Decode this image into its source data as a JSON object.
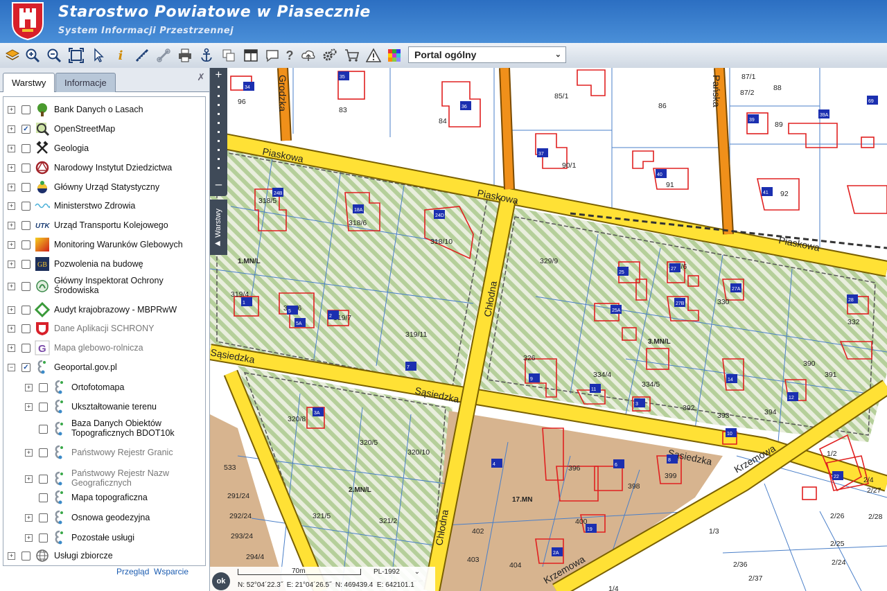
{
  "header": {
    "title": "Starostwo Powiatowe w Piasecznie",
    "subtitle": "System Informacji Przestrzennej"
  },
  "toolbar": {
    "icons": [
      "layers-icon",
      "zoom-in-icon",
      "zoom-out-icon",
      "full-extent-icon",
      "pointer-icon",
      "info-icon",
      "measure-distance-icon",
      "measure-area-icon",
      "print-icon",
      "anchor-icon",
      "copy-icon",
      "layout-icon",
      "comment-icon",
      "help-icon",
      "upload-icon",
      "settings-icon",
      "cart-icon",
      "warning-icon",
      "grid-color-icon"
    ],
    "portal_select": "Portal ogólny"
  },
  "panel": {
    "tabs": [
      "Warstwy",
      "Informacje"
    ],
    "layers": [
      {
        "label": "Bank Danych o Lasach",
        "checked": false,
        "expandable": true,
        "level": 0,
        "muted": false,
        "icon": "tree-icon"
      },
      {
        "label": "OpenStreetMap",
        "checked": true,
        "expandable": true,
        "level": 0,
        "muted": false,
        "icon": "magnifier-map-icon"
      },
      {
        "label": "Geologia",
        "checked": false,
        "expandable": true,
        "level": 0,
        "muted": false,
        "icon": "hammers-icon"
      },
      {
        "label": "Narodowy Instytut Dziedzictwa",
        "checked": false,
        "expandable": true,
        "level": 0,
        "muted": false,
        "icon": "heritage-icon"
      },
      {
        "label": "Główny Urząd Statystyczny",
        "checked": false,
        "expandable": true,
        "level": 0,
        "muted": false,
        "icon": "statistics-icon"
      },
      {
        "label": "Ministerstwo Zdrowia",
        "checked": false,
        "expandable": true,
        "level": 0,
        "muted": false,
        "icon": "wave-icon"
      },
      {
        "label": "Urząd Transportu Kolejowego",
        "checked": false,
        "expandable": true,
        "level": 0,
        "muted": false,
        "icon": "rail-icon"
      },
      {
        "label": "Monitoring Warunków Glebowych",
        "checked": false,
        "expandable": true,
        "level": 0,
        "muted": false,
        "icon": "soil-gradient-icon"
      },
      {
        "label": "Pozwolenia na budowę",
        "checked": false,
        "expandable": true,
        "level": 0,
        "muted": false,
        "icon": "building-permit-icon"
      },
      {
        "label": "Główny Inspektorat Ochrony Środowiska",
        "checked": false,
        "expandable": true,
        "level": 0,
        "muted": false,
        "icon": "environment-icon"
      },
      {
        "label": "Audyt krajobrazowy - MBPRwW",
        "checked": false,
        "expandable": true,
        "level": 0,
        "muted": false,
        "icon": "landscape-icon"
      },
      {
        "label": "Dane Aplikacji SCHRONY",
        "checked": false,
        "expandable": true,
        "level": 0,
        "muted": true,
        "icon": "shelter-shield-icon"
      },
      {
        "label": "Mapa glebowo-rolnicza",
        "checked": false,
        "expandable": true,
        "level": 0,
        "muted": true,
        "icon": "g-letter-icon"
      },
      {
        "label": "Geoportal.gov.pl",
        "checked": true,
        "expandable": true,
        "expanded": true,
        "level": 0,
        "muted": false,
        "icon": "geoportal-icon"
      },
      {
        "label": "Ortofotomapa",
        "checked": false,
        "expandable": true,
        "level": 1,
        "muted": false,
        "icon": "geoportal-icon"
      },
      {
        "label": "Ukształtowanie terenu",
        "checked": false,
        "expandable": true,
        "level": 1,
        "muted": false,
        "icon": "geoportal-icon"
      },
      {
        "label": "Baza Danych Obiektów Topograficznych BDOT10k",
        "checked": false,
        "expandable": false,
        "level": 1,
        "muted": false,
        "icon": "geoportal-icon"
      },
      {
        "label": "Państwowy Rejestr Granic",
        "checked": false,
        "expandable": true,
        "level": 1,
        "muted": true,
        "icon": "geoportal-icon"
      },
      {
        "label": "Państwowy Rejestr Nazw Geograficznych",
        "checked": false,
        "expandable": true,
        "level": 1,
        "muted": true,
        "icon": "geoportal-icon"
      },
      {
        "label": "Mapa topograficzna",
        "checked": false,
        "expandable": false,
        "level": 1,
        "muted": false,
        "icon": "geoportal-icon"
      },
      {
        "label": "Osnowa geodezyjna",
        "checked": false,
        "expandable": true,
        "level": 1,
        "muted": false,
        "icon": "geoportal-icon"
      },
      {
        "label": "Pozostałe usługi",
        "checked": false,
        "expandable": true,
        "level": 1,
        "muted": false,
        "icon": "geoportal-icon"
      },
      {
        "label": "Usługi zbiorcze",
        "checked": false,
        "expandable": true,
        "level": 0,
        "muted": false,
        "icon": "globe-icon"
      }
    ],
    "footer_links": [
      "Przegląd",
      "Wsparcie"
    ]
  },
  "map": {
    "side_tab": "Warstwy",
    "streets": [
      "Grodzka",
      "Pańska",
      "Piaskowa",
      "Piaskowa",
      "Piaskowa",
      "Chłodna",
      "Chłodna",
      "Sąsiedzka",
      "Sąsiedzka",
      "Sąsiedzka",
      "Krzemowa",
      "Krzemowa"
    ],
    "zones": [
      "1.MN/L",
      "3.MN/L",
      "2.MN/L",
      "17.MN"
    ],
    "parcels": [
      "96",
      "83",
      "84",
      "85/1",
      "86",
      "87/1",
      "87/2",
      "88",
      "89",
      "90/1",
      "91",
      "92",
      "318/5",
      "318/6",
      "318/10",
      "319/4",
      "319/6",
      "319/7",
      "319/11",
      "320/8",
      "320/5",
      "320/10",
      "321/5",
      "321/2",
      "329/9",
      "329/6",
      "330",
      "332",
      "334/4",
      "334/5",
      "392",
      "393",
      "394",
      "391",
      "390",
      "326",
      "396",
      "398",
      "399",
      "400",
      "402",
      "403",
      "404",
      "533",
      "291/24",
      "292/24",
      "293/24",
      "294/4",
      "1/2",
      "1/3",
      "1/4",
      "2/4",
      "2/26",
      "2/25",
      "2/24",
      "2/27",
      "2/28",
      "2/36",
      "2/37"
    ],
    "house_numbers": [
      "34",
      "35",
      "36",
      "37",
      "39",
      "39A",
      "40",
      "41",
      "69",
      "24B",
      "18A",
      "24D",
      "1",
      "5",
      "5A",
      "2",
      "7",
      "25",
      "25A",
      "27",
      "27A",
      "27B",
      "28",
      "9",
      "11",
      "3",
      "4",
      "6",
      "8",
      "10",
      "12",
      "14",
      "19",
      "22",
      "2A",
      "3A"
    ]
  },
  "status": {
    "scale_label": "70m",
    "crs": "PL-1992",
    "coords": "N: 52°04´22.3˝  E: 21°04´26.5˝  N: 469439.4  E: 642101.1",
    "ok": "ok"
  }
}
